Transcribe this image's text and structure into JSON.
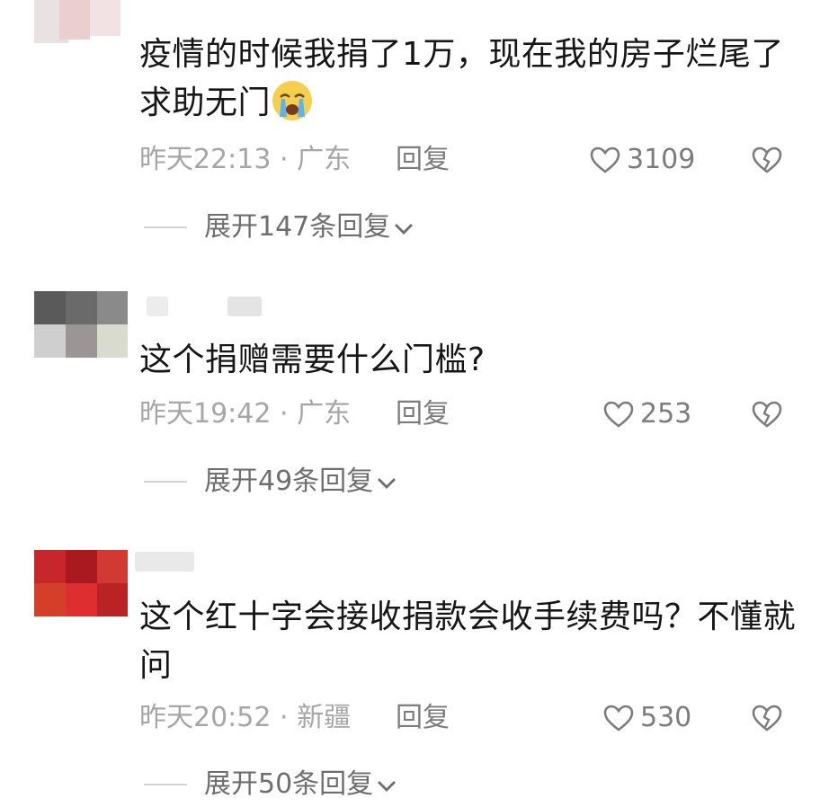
{
  "comments": [
    {
      "text": "疫情的时候我捐了1万，现在我的房子烂尾了求助无门",
      "time_location": "昨天22:13 · 广东",
      "reply_label": "回复",
      "likes": "3109",
      "expand_label": "展开147条回复"
    },
    {
      "text": "这个捐赠需要什么门槛?",
      "time_location": "昨天19:42 · 广东",
      "reply_label": "回复",
      "likes": "253",
      "expand_label": "展开49条回复"
    },
    {
      "text": "这个红十字会接收捐款会收手续费吗？不懂就问",
      "time_location": "昨天20:52 · 新疆",
      "reply_label": "回复",
      "likes": "530",
      "expand_label": "展开50条回复"
    }
  ],
  "icons": {
    "like": "heart-outline-icon",
    "dislike": "broken-heart-icon",
    "expand": "chevron-down-icon",
    "emoji": "crying-face-emoji"
  },
  "colors": {
    "text": "#161616",
    "meta": "#a6a6a6",
    "action": "#7c7c7c"
  }
}
